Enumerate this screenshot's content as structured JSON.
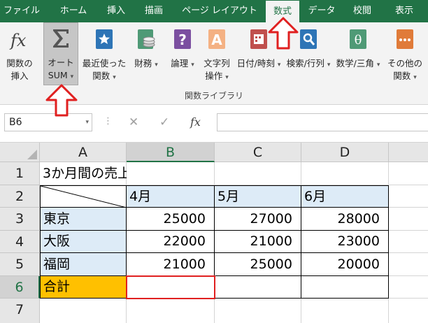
{
  "tabs": [
    "ファイル",
    "ホーム",
    "挿入",
    "描画",
    "ページ レイアウト",
    "数式",
    "データ",
    "校閲",
    "表示"
  ],
  "active_tab": "数式",
  "ribbon": {
    "commands": [
      {
        "line1": "関数の",
        "line2": "挿入",
        "icon": "function-fx-icon"
      },
      {
        "line1": "オート",
        "line2": "SUM",
        "icon": "sigma-autosum-icon"
      },
      {
        "line1": "最近使った",
        "line2": "関数",
        "icon": "star-recent-icon"
      },
      {
        "line1": "財務",
        "line2": "",
        "icon": "coins-finance-icon"
      },
      {
        "line1": "論理",
        "line2": "",
        "icon": "question-logical-icon"
      },
      {
        "line1": "文字列",
        "line2": "操作",
        "icon": "text-a-icon"
      },
      {
        "line1": "日付/時刻",
        "line2": "",
        "icon": "calendar-clock-icon"
      },
      {
        "line1": "検索/行列",
        "line2": "",
        "icon": "search-lookup-icon"
      },
      {
        "line1": "数学/三角",
        "line2": "",
        "icon": "theta-math-icon"
      },
      {
        "line1": "その他の",
        "line2": "関数",
        "icon": "more-functions-icon"
      }
    ],
    "group_label": "関数ライブラリ",
    "colors": {
      "accent": "#217346",
      "selected_cmd": "#c6c6c6"
    }
  },
  "formula_bar": {
    "name_box": "B6",
    "fx_label": "fx",
    "formula": ""
  },
  "sheet": {
    "columns": [
      "A",
      "B",
      "C",
      "D"
    ],
    "rows": [
      "1",
      "2",
      "3",
      "4",
      "5",
      "6",
      "7"
    ],
    "title": "3か月間の売上",
    "months": [
      "4月",
      "5月",
      "6月"
    ],
    "data_rows": [
      {
        "label": "東京",
        "values": [
          "25000",
          "27000",
          "28000"
        ]
      },
      {
        "label": "大阪",
        "values": [
          "22000",
          "21000",
          "23000"
        ]
      },
      {
        "label": "福岡",
        "values": [
          "21000",
          "25000",
          "20000"
        ]
      }
    ],
    "total_label": "合計",
    "selected_cell": "B6",
    "colors": {
      "header_fill": "#ddebf7",
      "total_fill": "#ffc000",
      "selection_border": "#e02020"
    }
  },
  "annotations": {
    "arrow_color": "#e02020"
  }
}
